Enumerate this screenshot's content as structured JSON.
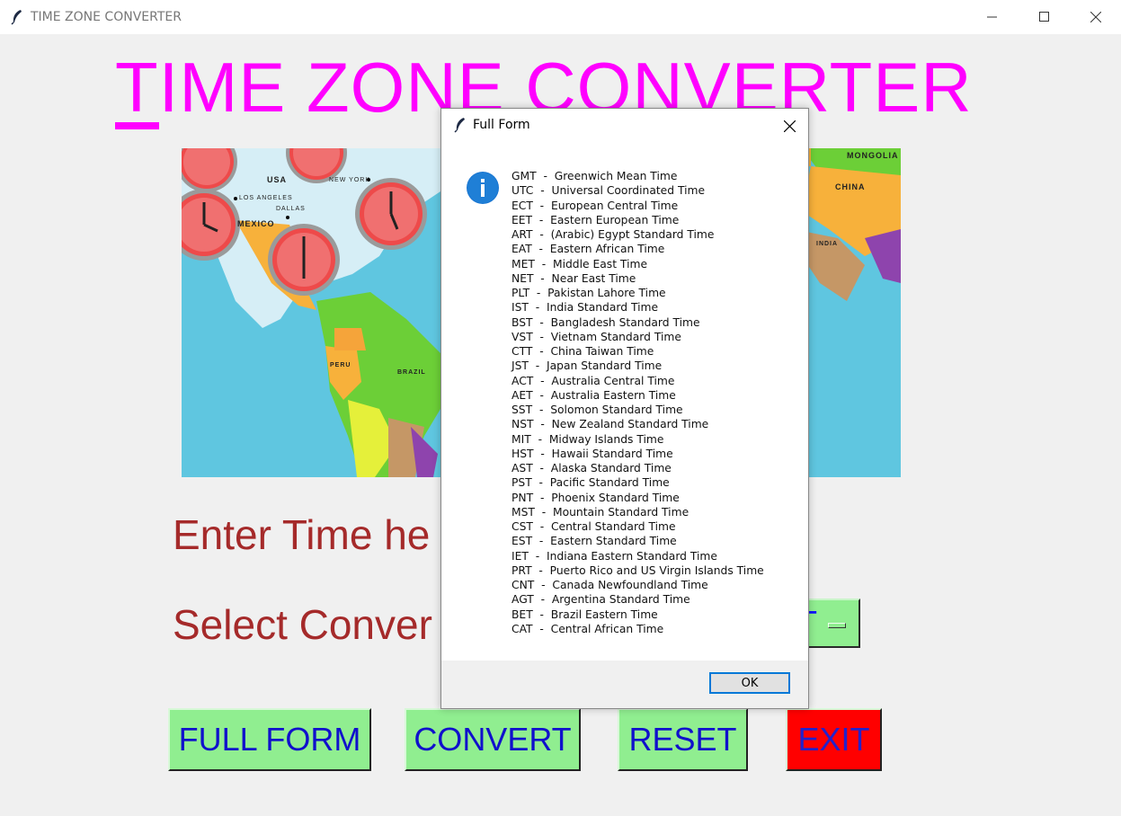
{
  "window": {
    "title": "TIME ZONE CONVERTER",
    "icon": "feather-icon"
  },
  "heading": {
    "first_letter": "T",
    "rest": "IME ZONE CONVERTER"
  },
  "map": {
    "labels": {
      "usa": "USA",
      "los_angeles": "LOS ANGELES",
      "new_york": "NEW YORK",
      "dallas": "DALLAS",
      "mexico": "MEXICO",
      "peru": "PERU",
      "brazil": "BRAZIL",
      "mongolia": "MONGOLIA",
      "china": "CHINA",
      "india": "INDIA"
    }
  },
  "form": {
    "enter_time_label": "Enter Time he",
    "select_convert_label": "Select Conver",
    "dropdown_value": "T"
  },
  "buttons": {
    "full_form": "FULL FORM",
    "convert": "CONVERT",
    "reset": "RESET",
    "exit": "EXIT"
  },
  "dialog": {
    "title": "Full Form",
    "ok_label": "OK",
    "entries": [
      "GMT  -  Greenwich Mean Time",
      "UTC  -  Universal Coordinated Time",
      "ECT  -  European Central Time",
      "EET  -  Eastern European Time",
      "ART  -  (Arabic) Egypt Standard Time",
      "EAT  -  Eastern African Time",
      "MET  -  Middle East Time",
      "NET  -  Near East Time",
      "PLT  -  Pakistan Lahore Time",
      "IST  -  India Standard Time",
      "BST  -  Bangladesh Standard Time",
      "VST  -  Vietnam Standard Time",
      "CTT  -  China Taiwan Time",
      "JST  -  Japan Standard Time",
      "ACT  -  Australia Central Time",
      "AET  -  Australia Eastern Time",
      "SST  -  Solomon Standard Time",
      "NST  -  New Zealand Standard Time",
      "MIT  -  Midway Islands Time",
      "HST  -  Hawaii Standard Time",
      "AST  -  Alaska Standard Time",
      "PST  -  Pacific Standard Time",
      "PNT  -  Phoenix Standard Time",
      "MST  -  Mountain Standard Time",
      "CST  -  Central Standard Time",
      "EST  -  Eastern Standard Time",
      "IET  -  Indiana Eastern Standard Time",
      "PRT  -  Puerto Rico and US Virgin Islands Time",
      "CNT  -  Canada Newfoundland Time",
      "AGT  -  Argentina Standard Time",
      "BET  -  Brazil Eastern Time",
      "CAT  -  Central African Time"
    ]
  },
  "colors": {
    "heading": "#ff00ff",
    "label": "#a52a2a",
    "button_bg": "#90ee90",
    "button_text": "#1010cc",
    "exit_bg": "#ff0000",
    "ocean": "#5fc6e0"
  }
}
